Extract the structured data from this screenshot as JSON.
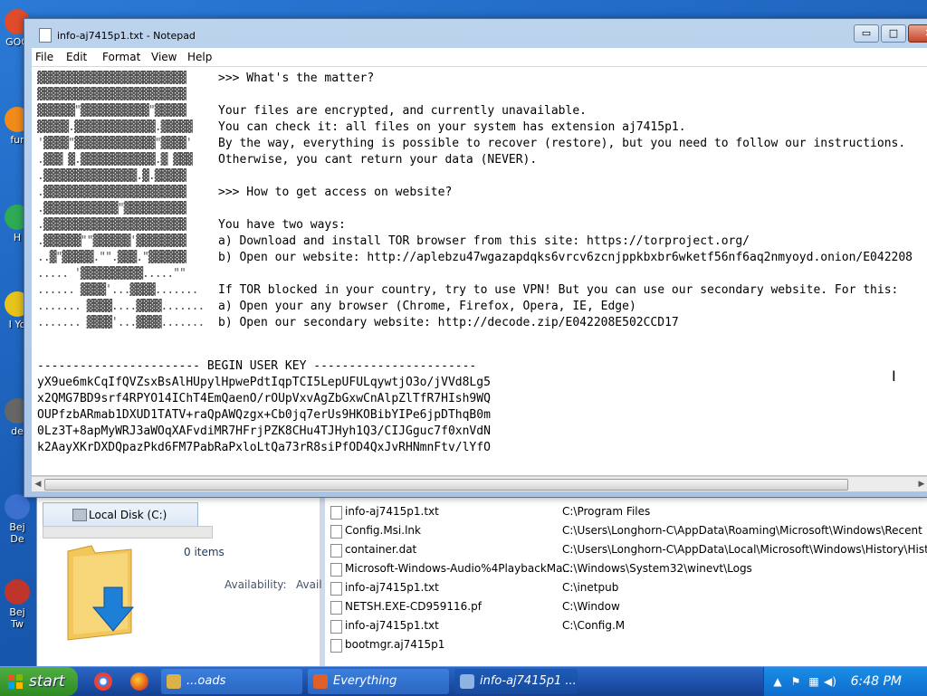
{
  "desktop": {
    "icons": [
      {
        "label": "GOO",
        "color": "#e04b2b"
      },
      {
        "label": "fur",
        "color": "#f08a1a"
      },
      {
        "label": "H",
        "color": "#2eaa55"
      },
      {
        "label": "I Yo",
        "color": "#e6c21a"
      },
      {
        "label": "de",
        "color": "#666666"
      },
      {
        "label": "Bej De",
        "color": "#3b6fd0"
      },
      {
        "label": "Bej Tw",
        "color": "#c0352b"
      }
    ]
  },
  "notepad": {
    "title": "info-aj7415p1.txt - Notepad",
    "controls": {
      "minimize": "▭",
      "maximize": "□",
      "close": "✕"
    },
    "menu": [
      "File",
      "Edit",
      "Format",
      "View",
      "Help"
    ],
    "lines": [
      {
        "art": "▓▓▓▓▓▓▓▓▓▓▓▓▓▓▓▓▓▓▓▓▓▓▓▓",
        "text": ">>> What's the matter?"
      },
      {
        "art": "▓▓▓▓▓▓▓▓▓▓▓▓▓▓▓▓▓▓▓▓▓▓▓▓",
        "text": ""
      },
      {
        "art": "▓▓▓▓▓▓\"▓▓▓▓▓▓▓▓▓▓▓\"▓▓▓▓▓",
        "text": "Your files are encrypted, and currently unavailable."
      },
      {
        "art": "▓▓▓▓▓.▓▓▓▓▓▓▓▓▓▓▓▓▓.▓▓▓▓▓",
        "text": "You can check it: all files on your system has extension aj7415p1."
      },
      {
        "art": "'▓▓▓▓\"▓▓▓▓▓▓▓▓▓▓▓▓▓\"▓▓▓▓'",
        "text": "By the way, everything is possible to recover (restore), but you need to follow our instructions."
      },
      {
        "art": ".▓▓▓ ▓.▓▓▓▓▓▓▓▓▓▓▓▓.▓ ▓▓▓",
        "text": "Otherwise, you cant return your data (NEVER)."
      },
      {
        "art": ".▓▓▓▓▓▓▓▓▓▓▓▓▓▓▓.▓.▓▓▓▓▓",
        "text": ""
      },
      {
        "art": ".▓▓▓▓▓▓▓▓▓▓▓▓▓▓▓▓▓▓▓▓▓▓▓",
        "text": ">>> How to get access on website?"
      },
      {
        "art": ".▓▓▓▓▓▓▓▓▓▓▓▓\"▓▓▓▓▓▓▓▓▓▓",
        "text": ""
      },
      {
        "art": ".▓▓▓▓▓▓▓▓▓▓▓▓▓▓▓▓▓▓▓▓▓▓▓",
        "text": "You have two ways:"
      },
      {
        "art": ".▓▓▓▓▓▓\"\"▓▓▓▓▓▓'▓▓▓▓▓▓▓▓",
        "text": "a) Download and install TOR browser from this site: https://torproject.org/"
      },
      {
        "art": "..▓\"▓▓▓▓▓.\"\".▓▓▓.\"▓▓▓▓▓▓",
        "text": "b) Open our website: http://aplebzu47wgazapdqks6vrcv6zcnjppkbxbr6wketf56nf6aq2nmyoyd.onion/E042208"
      },
      {
        "art": "..... '▓▓▓▓▓▓▓▓▓▓.....\"\"",
        "text": ""
      },
      {
        "art": "...... ▓▓▓▓'...▓▓▓▓.......",
        "text": "If TOR blocked in your country, try to use VPN! But you can use our secondary website. For this:"
      },
      {
        "art": "....... ▓▓▓▓....▓▓▓▓.......",
        "text": "a) Open your any browser (Chrome, Firefox, Opera, IE, Edge)"
      },
      {
        "art": "....... ▓▓▓▓'...▓▓▓▓.......",
        "text": "b) Open our secondary website: http://decode.zip/E042208E502CCD17"
      }
    ],
    "key_header": "----------------------- BEGIN USER KEY -----------------------",
    "key_lines": [
      "yX9ue6mkCqIfQVZsxBsAlHUpylHpwePdtIqpTCI5LepUFULqywtjO3o/jVVd8Lg5",
      "x2QMG7BD9srf4RPYO14IChT4EmQaenO/rOUpVxvAgZbGxwCnAlpZlTfR7HIsh9WQ",
      "OUPfzbARmab1DXUD1TATV+raQpAWQzgx+Cb0jq7erUs9HKOBibYIPe6jpDThqB0m",
      "0Lz3T+8apMyWRJ3aWOqXAFvdiMR7HFrjPZK8CHu4TJHyh1Q3/CIJGguc7f0xnVdN",
      "k2AayXKrDXDQpazPkd6FM7PabRaPxloLtQa73rR8siPfOD4QxJvRHNmnFtv/lYfO"
    ]
  },
  "explorer": {
    "nav_label": "Local Disk (C:)",
    "items_count": "0 items",
    "availability_label": "Availability:",
    "availability_value": "Avail",
    "files": [
      {
        "name": "info-aj7415p1.txt",
        "path": "C:\\Program Files"
      },
      {
        "name": "Config.Msi.lnk",
        "path": "C:\\Users\\Longhorn-C\\AppData\\Roaming\\Microsoft\\Windows\\Recent"
      },
      {
        "name": "container.dat",
        "path": "C:\\Users\\Longhorn-C\\AppData\\Local\\Microsoft\\Windows\\History\\Histo"
      },
      {
        "name": "Microsoft-Windows-Audio%4PlaybackMa...",
        "path": "C:\\Windows\\System32\\winevt\\Logs"
      },
      {
        "name": "info-aj7415p1.txt",
        "path": "C:\\inetpub"
      },
      {
        "name": "NETSH.EXE-CD959116.pf",
        "path": "C:\\Window"
      },
      {
        "name": "info-aj7415p1.txt",
        "path": "C:\\Config.M"
      },
      {
        "name": "bootmgr.aj7415p1",
        "path": ""
      }
    ]
  },
  "taskbar": {
    "start_label": "start",
    "tasks": [
      {
        "label": "...oads",
        "color": "#d9b24a"
      },
      {
        "label": "Everything",
        "color": "#e0602a"
      },
      {
        "label": "info-aj7415p1 ...",
        "color": "#8fb3e0"
      }
    ],
    "clock": "6:48 PM"
  }
}
